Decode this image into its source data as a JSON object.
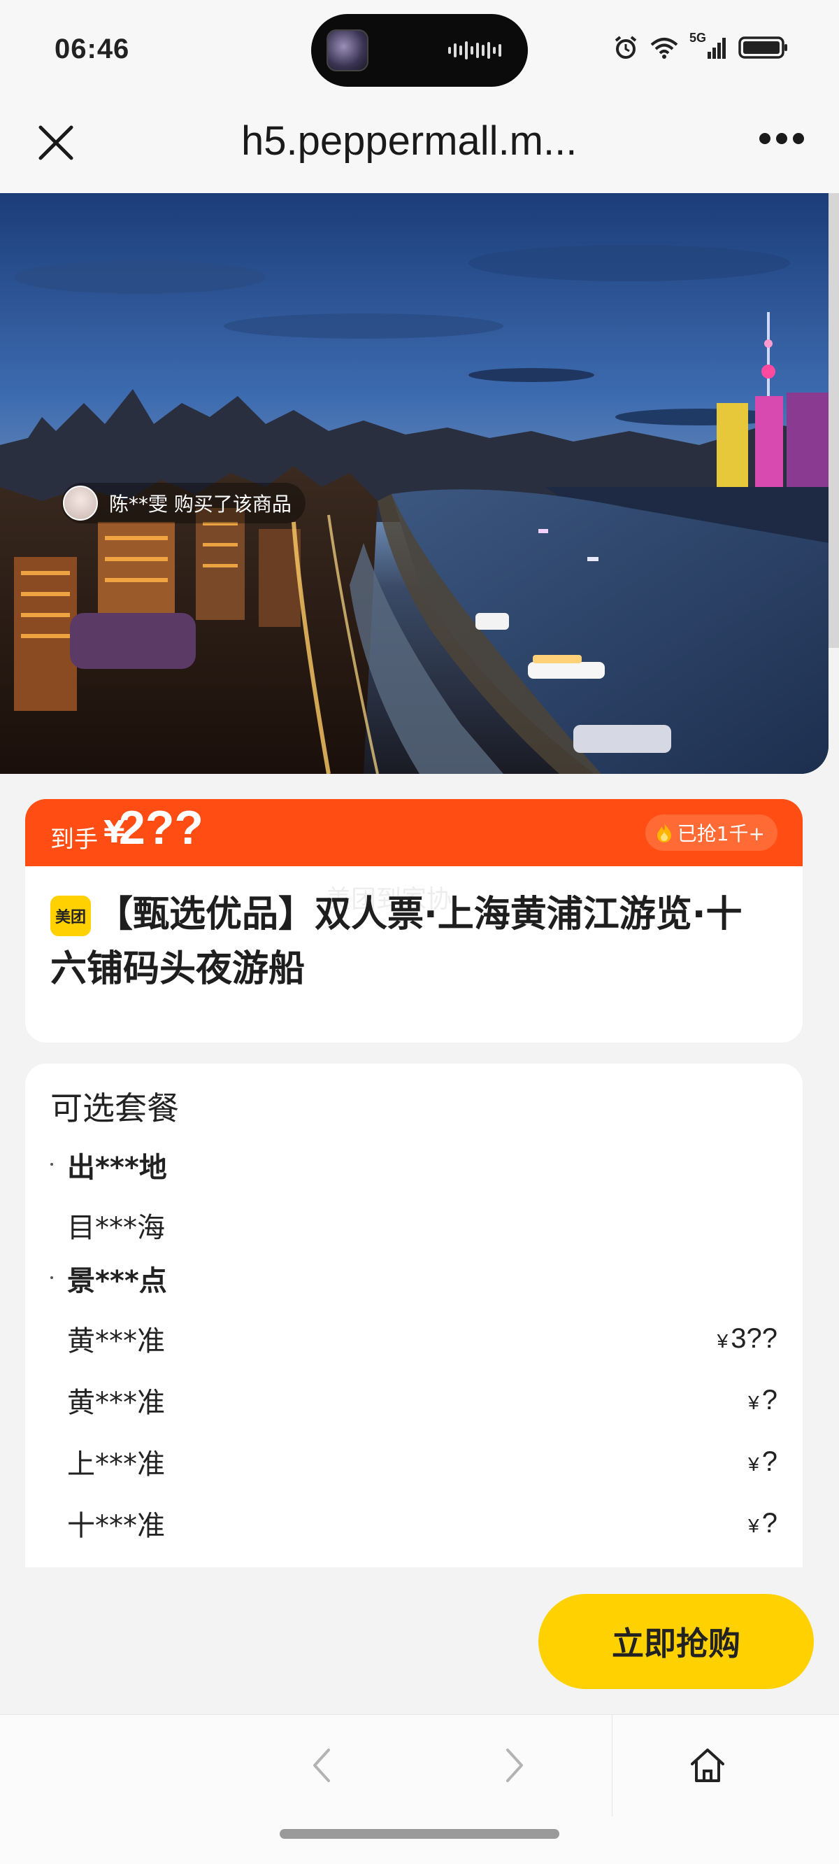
{
  "status_bar": {
    "time": "06:46",
    "network": "5G"
  },
  "nav": {
    "url_title": "h5.peppermall.m...",
    "close_icon": "close-icon",
    "more_icon": "more-icon"
  },
  "hero": {
    "buyer_notice": "陈**雯 购买了该商品"
  },
  "price": {
    "label": "到手",
    "currency": "¥",
    "value": "2??",
    "grab_count": "已抢1千+"
  },
  "product": {
    "brand_badge": "美团",
    "title": "【甄选优品】双人票·上海黄浦江游览·十六铺码头夜游船",
    "watermark": "美团到家协"
  },
  "packages": {
    "heading": "可选套餐",
    "rows": [
      {
        "name": "出***地",
        "section": true,
        "price": ""
      },
      {
        "name": "目***海",
        "section": false,
        "price": ""
      },
      {
        "name": "景***点",
        "section": true,
        "price": ""
      },
      {
        "name": "黄***准",
        "section": false,
        "price": "3??"
      },
      {
        "name": "黄***准",
        "section": false,
        "price": "?"
      },
      {
        "name": "上***准",
        "section": false,
        "price": "?"
      },
      {
        "name": "十***准",
        "section": false,
        "price": "?"
      }
    ],
    "currency": "¥"
  },
  "buy_button": {
    "label": "立即抢购"
  },
  "colors": {
    "price_bar": "#ff4d13",
    "buy_button": "#ffd100",
    "brand_badge": "#ffd100"
  }
}
